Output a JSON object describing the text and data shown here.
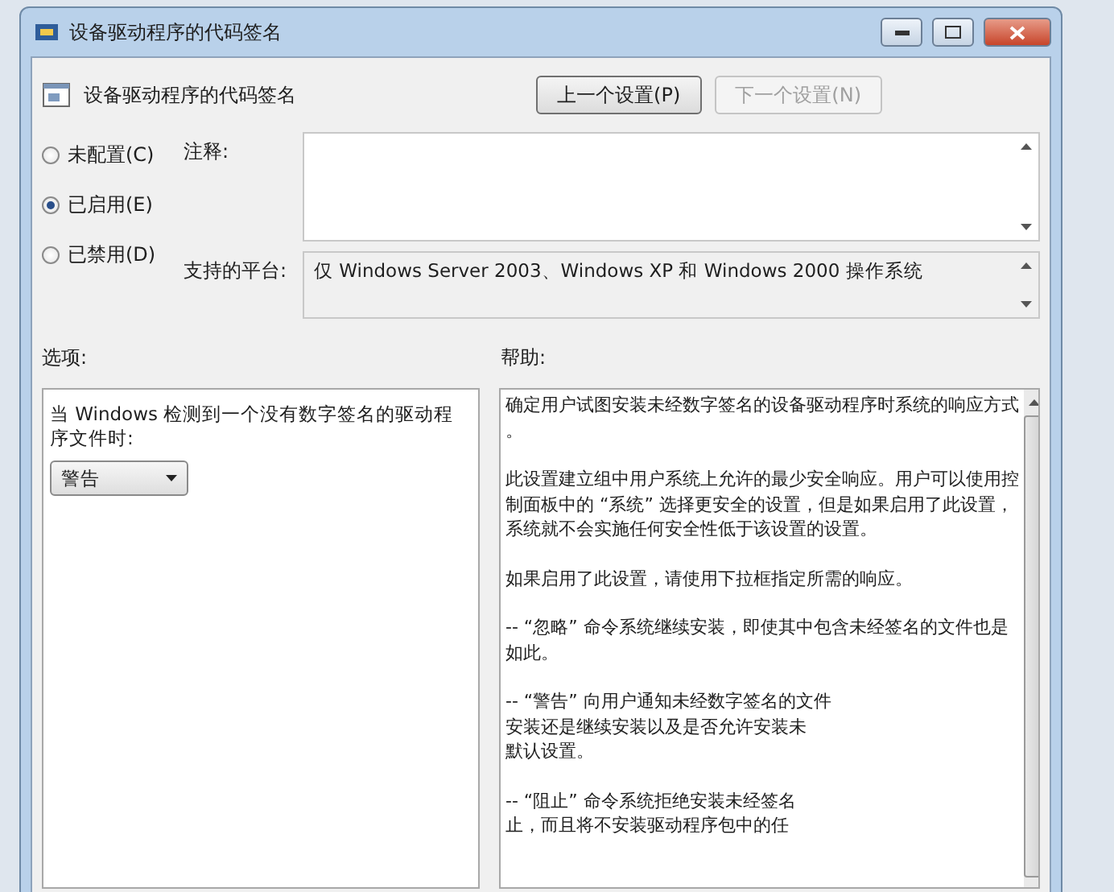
{
  "window": {
    "title": "设备驱动程序的代码签名"
  },
  "header": {
    "title": "设备驱动程序的代码签名",
    "buttons": [
      {
        "label": "上一个设置(P)",
        "disabled": false
      },
      {
        "label": "下一个设置(N)",
        "disabled": true
      }
    ]
  },
  "radios": [
    {
      "label": "未配置(C)",
      "selected": false
    },
    {
      "label": "已启用(E)",
      "selected": true
    },
    {
      "label": "已禁用(D)",
      "selected": false
    }
  ],
  "comment": {
    "label": "注释:"
  },
  "platform": {
    "label": "支持的平台:",
    "value": "仅 Windows Server 2003、Windows XP 和 Windows 2000 操作系统"
  },
  "options": {
    "label": "选项:",
    "prompt": "当 Windows 检测到一个没有数字签名的驱动程序文件时:",
    "dropdown": "警告"
  },
  "help": {
    "label": "帮助:",
    "paragraphs": [
      [
        "确定用户试图安装未经数字签名的设备驱动程序时系统的响应方式",
        "。"
      ],
      [
        "此设置建立组中用户系统上允许的最少安全响应。用户可以使用控",
        "制面板中的 “系统” 选择更安全的设置，但是如果启用了此设置，",
        "系统就不会实施任何安全性低于该设置的设置。"
      ],
      [
        "如果启用了此设置，请使用下拉框指定所需的响应。"
      ],
      [
        "-- “忽略” 命令系统继续安装，即使其中包含未经签名的文件也是",
        "如此。"
      ],
      [
        "-- “警告” 向用户通知未经数字签名的文件",
        "安装还是继续安装以及是否允许安装未",
        "默认设置。"
      ],
      [
        "-- “阻止” 命令系统拒绝安装未经签名",
        "止，而且将不安装驱动程序包中的任"
      ]
    ]
  }
}
